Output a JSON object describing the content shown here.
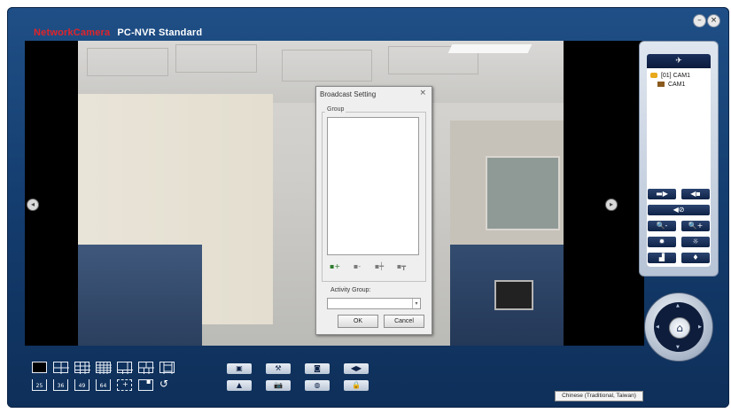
{
  "app": {
    "brand_primary": "NetworkCamera",
    "brand_secondary": "PC-NVR Standard",
    "colors": {
      "frame": "#1a4a80",
      "brand_red": "#e1242b",
      "ptz_button": "#1a2f5a"
    }
  },
  "window_controls": [
    {
      "name": "minimize-button",
      "icon": "minimize-icon",
      "glyph": "–"
    },
    {
      "name": "close-button",
      "icon": "close-icon",
      "glyph": "×"
    }
  ],
  "dialog": {
    "title": "Broadcast Setting",
    "close_glyph": "×",
    "group_label": "Group",
    "group_tools": [
      {
        "icon": "add-group-icon",
        "glyph": "▪+"
      },
      {
        "icon": "remove-group-icon",
        "glyph": "▪-"
      },
      {
        "icon": "add-member-icon",
        "glyph": "▪┿"
      },
      {
        "icon": "remove-member-icon",
        "glyph": "▪┳"
      }
    ],
    "activity_label": "Activity Group:",
    "activity_value": "",
    "ok_label": "OK",
    "cancel_label": "Cancel"
  },
  "device_tree": {
    "root": "[01] CAM1",
    "child": "CAM1"
  },
  "ptz_controls": [
    {
      "icon": "preset-left-icon",
      "glyph": "▬▶"
    },
    {
      "icon": "preset-right-icon",
      "glyph": "◀▪"
    },
    {
      "icon": "focus-stop-icon",
      "glyph": "◀⊘"
    },
    {
      "icon": "zoom-out-icon",
      "glyph": "🔍-"
    },
    {
      "icon": "zoom-in-icon",
      "glyph": "🔍+"
    },
    {
      "icon": "iris-close-icon",
      "glyph": "✹"
    },
    {
      "icon": "iris-open-icon",
      "glyph": "☼"
    },
    {
      "icon": "scan-icon",
      "glyph": "▟"
    },
    {
      "icon": "preset-point-icon",
      "glyph": "♦"
    }
  ],
  "layout_numbers": [
    "25",
    "36",
    "49",
    "64"
  ],
  "tools_row1": [
    {
      "icon": "snapshot-icon",
      "glyph": "▣"
    },
    {
      "icon": "settings-icon",
      "glyph": "⚒"
    },
    {
      "icon": "record-icon",
      "glyph": "◙"
    },
    {
      "icon": "sequence-icon",
      "glyph": "◀▶"
    }
  ],
  "tools_row2": [
    {
      "icon": "audio-icon",
      "glyph": "▲"
    },
    {
      "icon": "camera-icon",
      "glyph": "📷"
    },
    {
      "icon": "globe-icon",
      "glyph": "◍"
    },
    {
      "icon": "lock-icon",
      "glyph": "🔒"
    }
  ],
  "language": "Chinese (Traditional, Taiwan)"
}
